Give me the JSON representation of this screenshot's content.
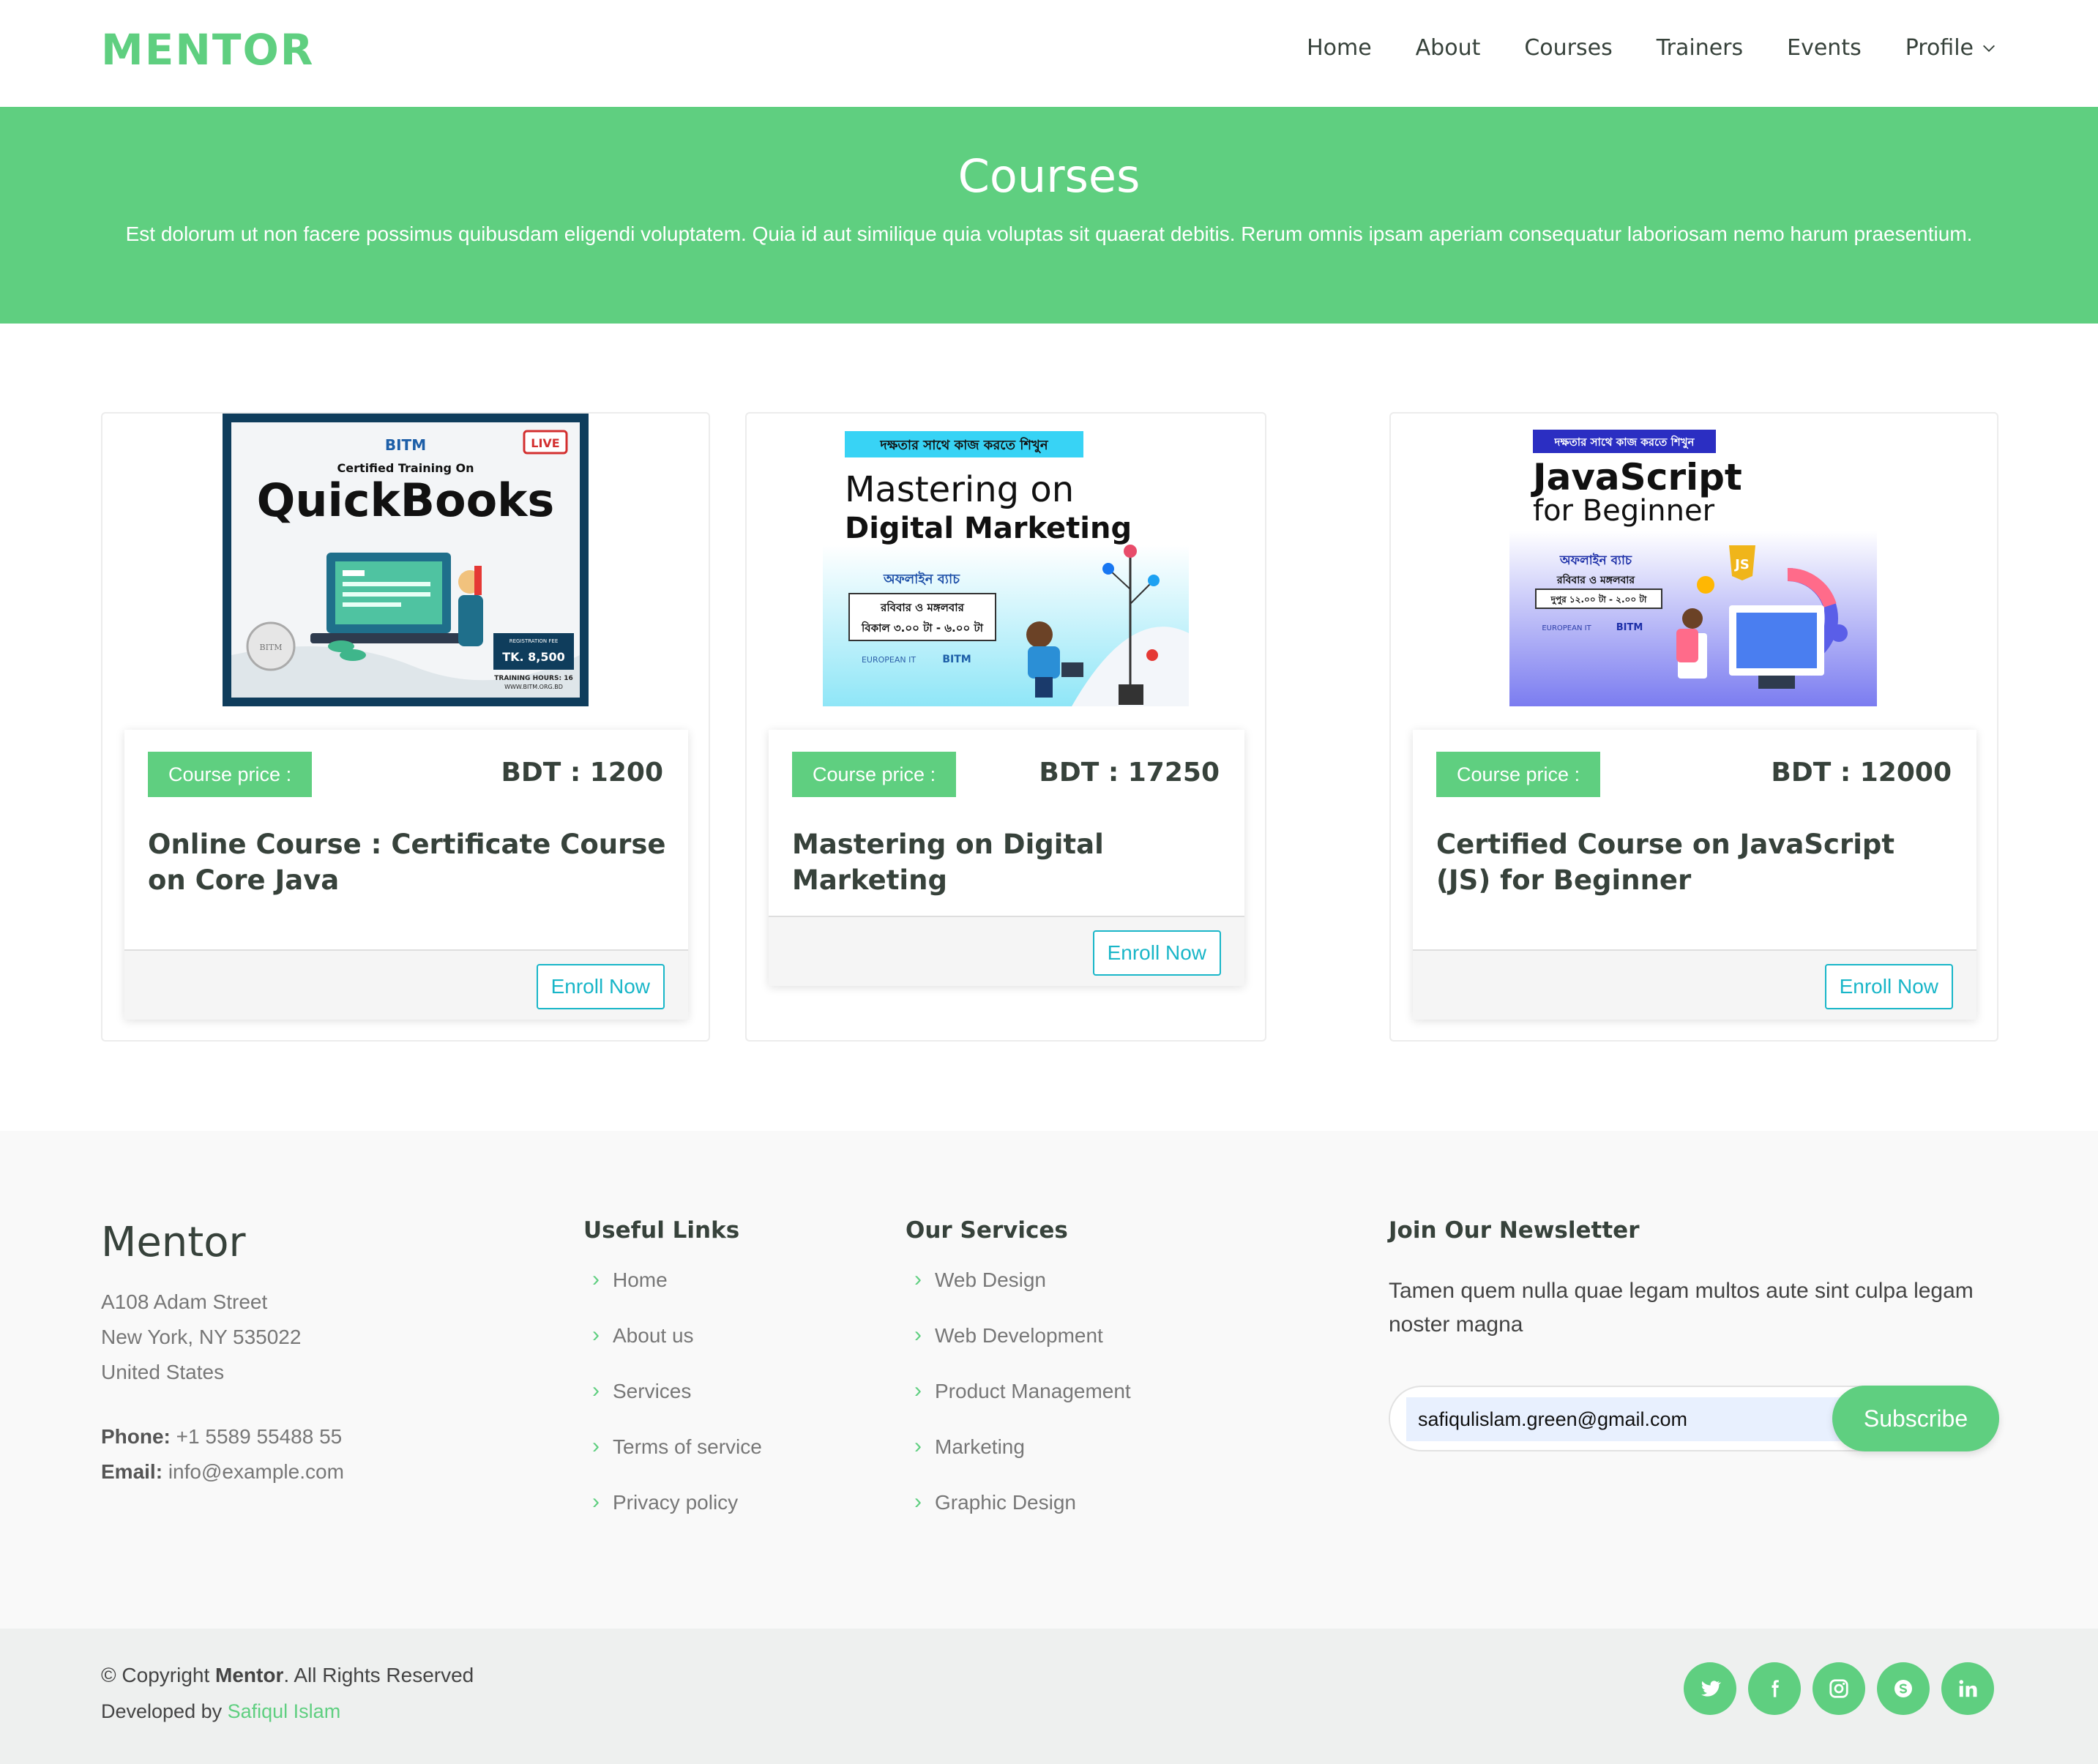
{
  "header": {
    "logo": "MENTOR",
    "nav": [
      "Home",
      "About",
      "Courses",
      "Trainers",
      "Events",
      "Profile"
    ]
  },
  "hero": {
    "title": "Courses",
    "text": "Est dolorum ut non facere possimus quibusdam eligendi voluptatem. Quia id aut similique quia voluptas sit quaerat debitis. Rerum omnis ipsam aperiam consequatur laboriosam nemo harum praesentium."
  },
  "courses": [
    {
      "price_label": "Course price :",
      "price": "BDT : 1200",
      "title": "Online Course : Certificate Course on Core Java",
      "enroll": "Enroll Now",
      "banner": {
        "brand": "BITM",
        "live": "LIVE",
        "subtitle": "Certified Training On",
        "headline": "QuickBooks",
        "fee_label": "REGISTRATION FEE",
        "fee": "TK. 8,500",
        "hours": "TRAINING HOURS: 16",
        "url": "WWW.BITM.ORG.BD",
        "seal": "BITM"
      }
    },
    {
      "price_label": "Course price :",
      "price": "BDT : 17250",
      "title": "Mastering on Digital Marketing",
      "enroll": "Enroll Now",
      "banner": {
        "tag": "দক্ষতার সাথে কাজ করতে শিখুন",
        "line1": "Mastering on",
        "line2": "Digital Marketing",
        "batch": "অফলাইন ব্যাচ",
        "days": "রবিবার ও মঙ্গলবার",
        "time": "বিকাল ৩.০০ টা - ৬.০০ টা",
        "partner": "EUROPEAN IT",
        "brand": "BITM"
      }
    },
    {
      "price_label": "Course price :",
      "price": "BDT : 12000",
      "title": "Certified Course on JavaScript (JS) for Beginner",
      "enroll": "Enroll Now",
      "banner": {
        "tag": "দক্ষতার সাথে কাজ করতে শিখুন",
        "line1": "JavaScript",
        "line2": "for Beginner",
        "batch": "অফলাইন ব্যাচ",
        "days": "রবিবার ও মঙ্গলবার",
        "time": "দুপুর ১২.০০ টা - ২.০০ টা",
        "partner": "EUROPEAN IT",
        "brand": "BITM",
        "js": "JS"
      }
    }
  ],
  "footer": {
    "brand": "Mentor",
    "address": [
      "A108 Adam Street",
      "New York, NY 535022",
      "United States"
    ],
    "phone_label": "Phone:",
    "phone": "+1 5589 55488 55",
    "email_label": "Email:",
    "email": "info@example.com",
    "useful_title": "Useful Links",
    "useful": [
      "Home",
      "About us",
      "Services",
      "Terms of service",
      "Privacy policy"
    ],
    "services_title": "Our Services",
    "services": [
      "Web Design",
      "Web Development",
      "Product Management",
      "Marketing",
      "Graphic Design"
    ],
    "news_title": "Join Our Newsletter",
    "news_text": "Tamen quem nulla quae legam multos aute sint culpa legam noster magna",
    "email_value": "safiqulislam.green@gmail.com",
    "subscribe": "Subscribe"
  },
  "bottom": {
    "copy_prefix": "© Copyright ",
    "copy_brand": "Mentor",
    "copy_suffix": ". All Rights Reserved",
    "dev_prefix": "Developed by ",
    "dev_name": "Safiqul Islam",
    "socials": [
      "twitter-icon",
      "facebook-icon",
      "instagram-icon",
      "skype-icon",
      "linkedin-icon"
    ]
  },
  "colors": {
    "accent": "#5fcf80",
    "enroll": "#19b6c8",
    "text": "#37423b"
  }
}
